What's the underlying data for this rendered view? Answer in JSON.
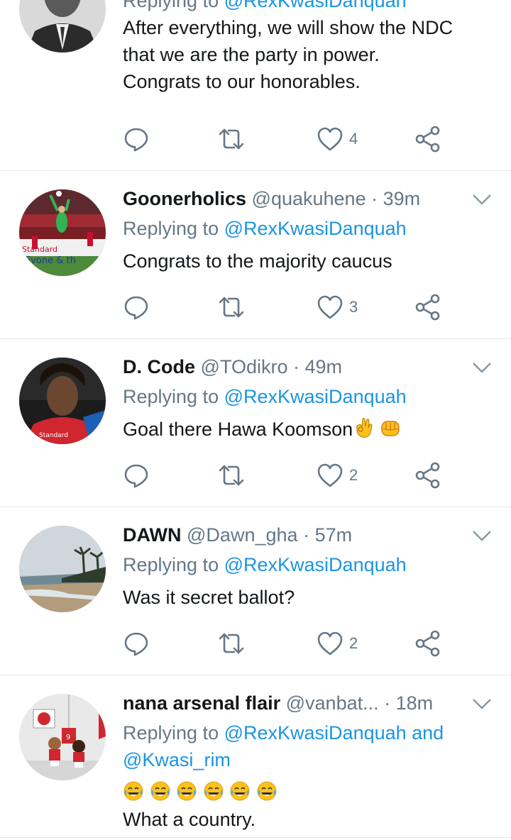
{
  "colors": {
    "text": "#14171a",
    "secondary": "#657786",
    "link": "#1b95e0",
    "divider": "#e1e8ed"
  },
  "tweets": [
    {
      "display_name": "",
      "handle": "",
      "time": "",
      "reply_prefix": "Replying to",
      "reply_to": "@RexKwasiDanquah",
      "reply_to_extra": "",
      "text_lines": [
        "After everything, we will show the NDC",
        "that we are the party in power.",
        "Congrats to our honorables."
      ],
      "reply_count": "",
      "retweet_count": "",
      "like_count": "4",
      "avatar_icon": "portrait-photo"
    },
    {
      "display_name": "Goonerholics",
      "handle": "@quakuhene",
      "time": "39m",
      "reply_prefix": "Replying to",
      "reply_to": "@RexKwasiDanquah",
      "text_lines": [
        "Congrats to the majority caucus"
      ],
      "like_count": "3",
      "avatar_icon": "football-stadium-photo"
    },
    {
      "display_name": "D. Code",
      "handle": "@TOdikro",
      "time": "49m",
      "reply_prefix": "Replying to",
      "reply_to": "@RexKwasiDanquah",
      "text_lines": [
        "Goal there Hawa Koomson"
      ],
      "emojis": [
        "ok-hand-emoji",
        "fist-emoji"
      ],
      "like_count": "2",
      "avatar_icon": "footballer-photo"
    },
    {
      "display_name": "DAWN",
      "handle": "@Dawn_gha",
      "time": "57m",
      "reply_prefix": "Replying to",
      "reply_to": "@RexKwasiDanquah",
      "text_lines": [
        "Was it secret ballot?"
      ],
      "like_count": "2",
      "avatar_icon": "beach-photo"
    },
    {
      "display_name": "nana arsenal flair",
      "handle": "@vanbat...",
      "time": "18m",
      "reply_prefix": "Replying to",
      "reply_to": "@RexKwasiDanquah and",
      "reply_to_extra": "@Kwasi_rim",
      "text_lines": [
        "What a country."
      ],
      "emojis": [
        "tears-of-joy-emoji",
        "tears-of-joy-emoji",
        "tears-of-joy-emoji",
        "tears-of-joy-emoji",
        "tears-of-joy-emoji",
        "tears-of-joy-emoji"
      ],
      "avatar_icon": "cartoon-players-photo"
    }
  ],
  "separator_dot": "·"
}
